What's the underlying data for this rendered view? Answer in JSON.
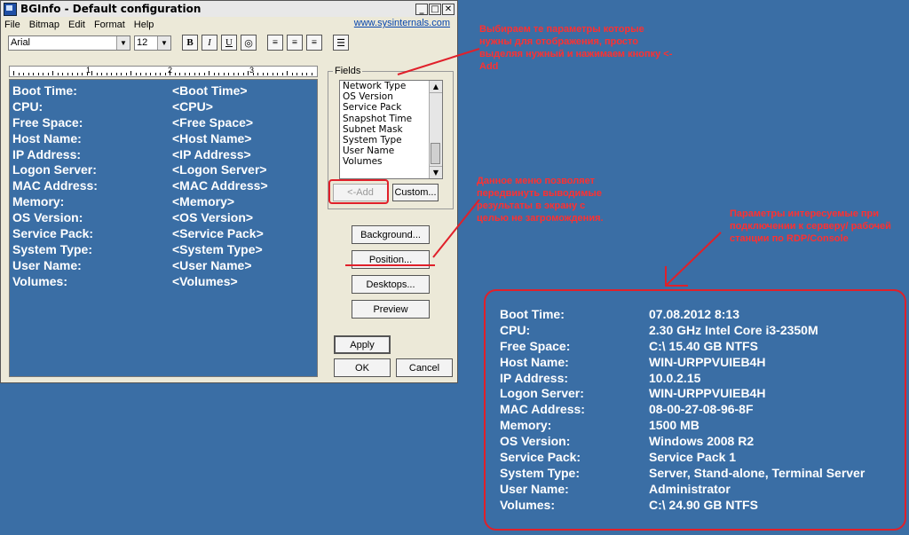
{
  "window": {
    "title": "BGInfo - Default configuration",
    "menu": [
      "File",
      "Bitmap",
      "Edit",
      "Format",
      "Help"
    ],
    "link": "www.sysinternals.com",
    "font_name": "Arial",
    "font_size": "12",
    "toolbar": {
      "bold": "B",
      "italic": "I",
      "underline": "U"
    }
  },
  "ruler": [
    "1",
    "2",
    "3"
  ],
  "editor_rows": [
    {
      "k": "Boot Time:",
      "v": "<Boot Time>"
    },
    {
      "k": "CPU:",
      "v": "<CPU>"
    },
    {
      "k": "Free Space:",
      "v": "<Free Space>"
    },
    {
      "k": "Host Name:",
      "v": "<Host Name>"
    },
    {
      "k": "IP Address:",
      "v": "<IP Address>"
    },
    {
      "k": "Logon Server:",
      "v": "<Logon Server>"
    },
    {
      "k": "MAC Address:",
      "v": "<MAC Address>"
    },
    {
      "k": "Memory:",
      "v": "<Memory>"
    },
    {
      "k": "OS Version:",
      "v": "<OS Version>"
    },
    {
      "k": "Service Pack:",
      "v": "<Service Pack>"
    },
    {
      "k": "System Type:",
      "v": "<System Type>"
    },
    {
      "k": "User Name:",
      "v": "<User Name>"
    },
    {
      "k": "Volumes:",
      "v": "<Volumes>"
    }
  ],
  "fields": {
    "label": "Fields",
    "items": [
      "Network Type",
      "OS Version",
      "Service Pack",
      "Snapshot Time",
      "Subnet Mask",
      "System Type",
      "User Name",
      "Volumes"
    ],
    "add": "<-Add",
    "custom": "Custom..."
  },
  "buttons": {
    "background": "Background...",
    "position": "Position...",
    "desktops": "Desktops...",
    "preview": "Preview",
    "apply": "Apply",
    "ok": "OK",
    "cancel": "Cancel"
  },
  "annotations": {
    "note1": "Выбираем те параметры которые нужны для отображения, просто выделяя нужный и нажимаем кнопку <-Add",
    "note2": "Данное меню позволяет передвинуть выводимые результаты в экрану с целью не загромождения.",
    "note3": "Параметры интересуемые при подключении к серверу/ рабочей станции по RDP/Console"
  },
  "desktop_info": [
    {
      "k": "Boot Time:",
      "v": "07.08.2012 8:13"
    },
    {
      "k": "CPU:",
      "v": "2.30 GHz Intel Core i3-2350M"
    },
    {
      "k": "Free Space:",
      "v": "C:\\ 15.40 GB NTFS"
    },
    {
      "k": "Host Name:",
      "v": "WIN-URPPVUIEB4H"
    },
    {
      "k": "IP Address:",
      "v": "10.0.2.15"
    },
    {
      "k": "Logon Server:",
      "v": "WIN-URPPVUIEB4H"
    },
    {
      "k": "MAC Address:",
      "v": "08-00-27-08-96-8F"
    },
    {
      "k": "Memory:",
      "v": "1500 MB"
    },
    {
      "k": "OS Version:",
      "v": "Windows 2008 R2"
    },
    {
      "k": "Service Pack:",
      "v": "Service Pack 1"
    },
    {
      "k": "System Type:",
      "v": "Server, Stand-alone, Terminal Server"
    },
    {
      "k": "User Name:",
      "v": "Administrator"
    },
    {
      "k": "Volumes:",
      "v": "C:\\ 24.90 GB NTFS"
    }
  ]
}
